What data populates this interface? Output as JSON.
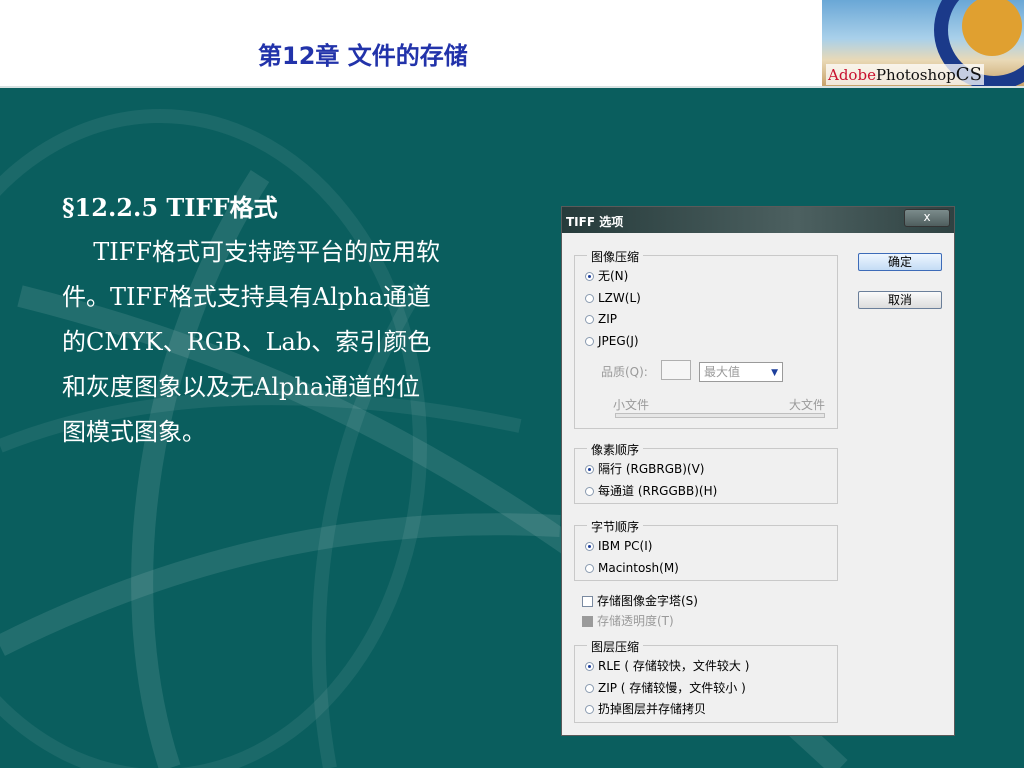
{
  "header": {
    "title": "第12章 文件的存储",
    "logo_adobe": "Adobe",
    "logo_photoshop": "Photoshop",
    "logo_cs": "CS"
  },
  "content": {
    "heading": "§12.2.5 TIFF格式",
    "paragraph": "TIFF格式可支持跨平台的应用软件。TIFF格式支持具有Alpha通道的CMYK、RGB、Lab、索引颜色和灰度图象以及无Alpha通道的位图模式图象。"
  },
  "dialog": {
    "title": "TIFF 选项",
    "close": "x",
    "ok": "确定",
    "cancel": "取消",
    "image_compression": {
      "legend": "图像压缩",
      "options": [
        "无(N)",
        "LZW(L)",
        "ZIP",
        "JPEG(J)"
      ],
      "quality_label": "品质(Q):",
      "quality_value": "",
      "quality_select": "最大值",
      "small_file": "小文件",
      "large_file": "大文件"
    },
    "pixel_order": {
      "legend": "像素顺序",
      "options": [
        "隔行 (RGBRGB)(V)",
        "每通道 (RRGGBB)(H)"
      ]
    },
    "byte_order": {
      "legend": "字节顺序",
      "options": [
        "IBM PC(I)",
        "Macintosh(M)"
      ]
    },
    "save_pyramid": "存储图像金字塔(S)",
    "save_transparency": "存储透明度(T)",
    "layer_compression": {
      "legend": "图层压缩",
      "options": [
        "RLE ( 存储较快，文件较大 )",
        "ZIP ( 存储较慢，文件较小 )",
        "扔掉图层并存储拷贝"
      ]
    }
  },
  "colors": {
    "background": "#0a5e5e",
    "title": "#2233aa",
    "text": "#ffffff"
  }
}
